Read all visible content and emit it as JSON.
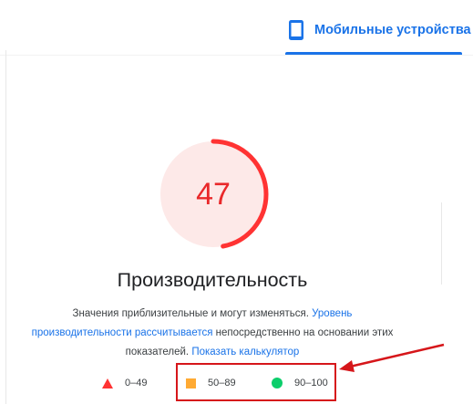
{
  "tab": {
    "label": "Мобильные устройства",
    "icon": "mobile-phone-icon",
    "accent": "#1a73e8"
  },
  "score": {
    "value": "47",
    "max": 100,
    "color": "#e9282a",
    "ring_bg": "#fde9e8"
  },
  "metric": {
    "title": "Производительность"
  },
  "note": {
    "text_1": "Значения приблизительные и могут изменяться.",
    "link_1": "Уровень производительности рассчитывается",
    "text_2": "непосредственно на основании этих показателей.",
    "link_2": "Показать калькулятор"
  },
  "legend": [
    {
      "label": "0–49",
      "icon": "red-triangle-icon",
      "color": "#ff3333"
    },
    {
      "label": "50–89",
      "icon": "orange-square-icon",
      "color": "#ffaa33"
    },
    {
      "label": "90–100",
      "icon": "green-circle-icon",
      "color": "#0cce6b"
    }
  ],
  "annotation": {
    "color": "#d6161a"
  }
}
